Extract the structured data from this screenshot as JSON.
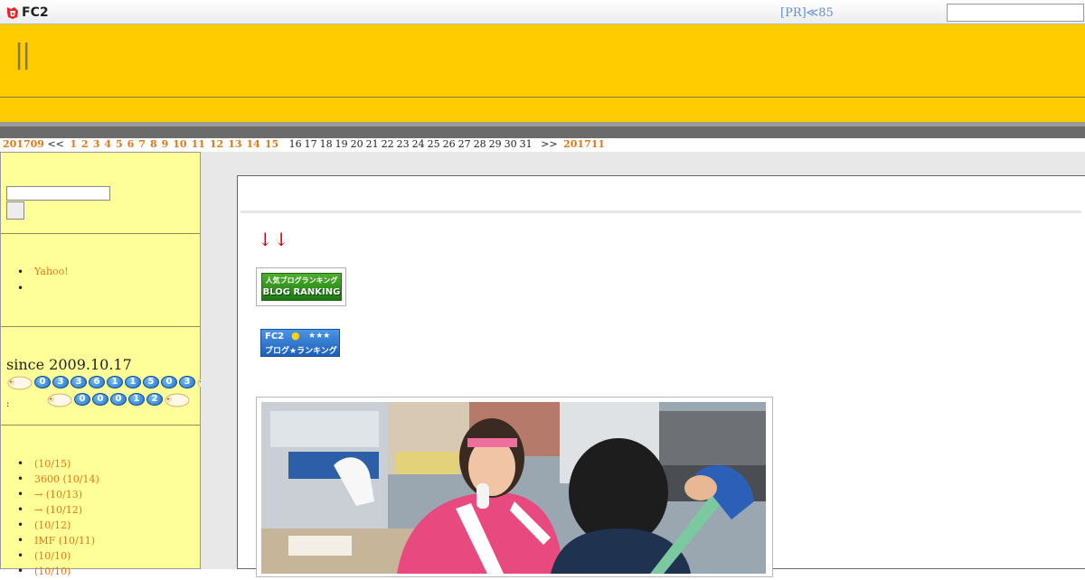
{
  "fc2bar": {
    "logo_text": "FC2",
    "pr_link": "[PR]≪85",
    "search_value": ""
  },
  "header": {
    "title": "||"
  },
  "calendar": {
    "prev_month": "201709",
    "prev_arrow": "<<",
    "days_linked": [
      "1",
      "2",
      "3",
      "4",
      "5",
      "6",
      "7",
      "8",
      "9",
      "10",
      "11",
      "12",
      "13",
      "14",
      "15"
    ],
    "days_plain": [
      "16",
      "17",
      "18",
      "19",
      "20",
      "21",
      "22",
      "23",
      "24",
      "25",
      "26",
      "27",
      "28",
      "29",
      "30",
      "31"
    ],
    "next_arrow": ">>",
    "next_month": "201711"
  },
  "sidebar": {
    "search_value": "",
    "links": [
      "Yahoo!",
      ""
    ],
    "since": "since 2009.10.17",
    "counter_total": [
      "0",
      "3",
      "3",
      "6",
      "1",
      "1",
      "5",
      "0",
      "3"
    ],
    "counter_today": [
      "0",
      "0",
      "0",
      "1",
      "2"
    ],
    "counter_colon": ":",
    "recent": [
      " (10/15)",
      "3600 (10/14)",
      "→ (10/13)",
      "→ (10/12)",
      " (10/12)",
      "IMF (10/11)",
      " (10/10)",
      " (10/10)"
    ]
  },
  "entry": {
    "arrows": "↓↓",
    "banner1": {
      "line1": "人気ブログランキング",
      "line2": "BLOG RANKING"
    },
    "banner2": {
      "line1": "FC2",
      "stars": "★★★",
      "line2": "ブログ★ランキング"
    }
  },
  "colors": {
    "header_yellow": "#ffcc00",
    "sidebar_yellow": "#ffff99",
    "link_orange": "#e07818",
    "arrow_red": "#d00000"
  }
}
